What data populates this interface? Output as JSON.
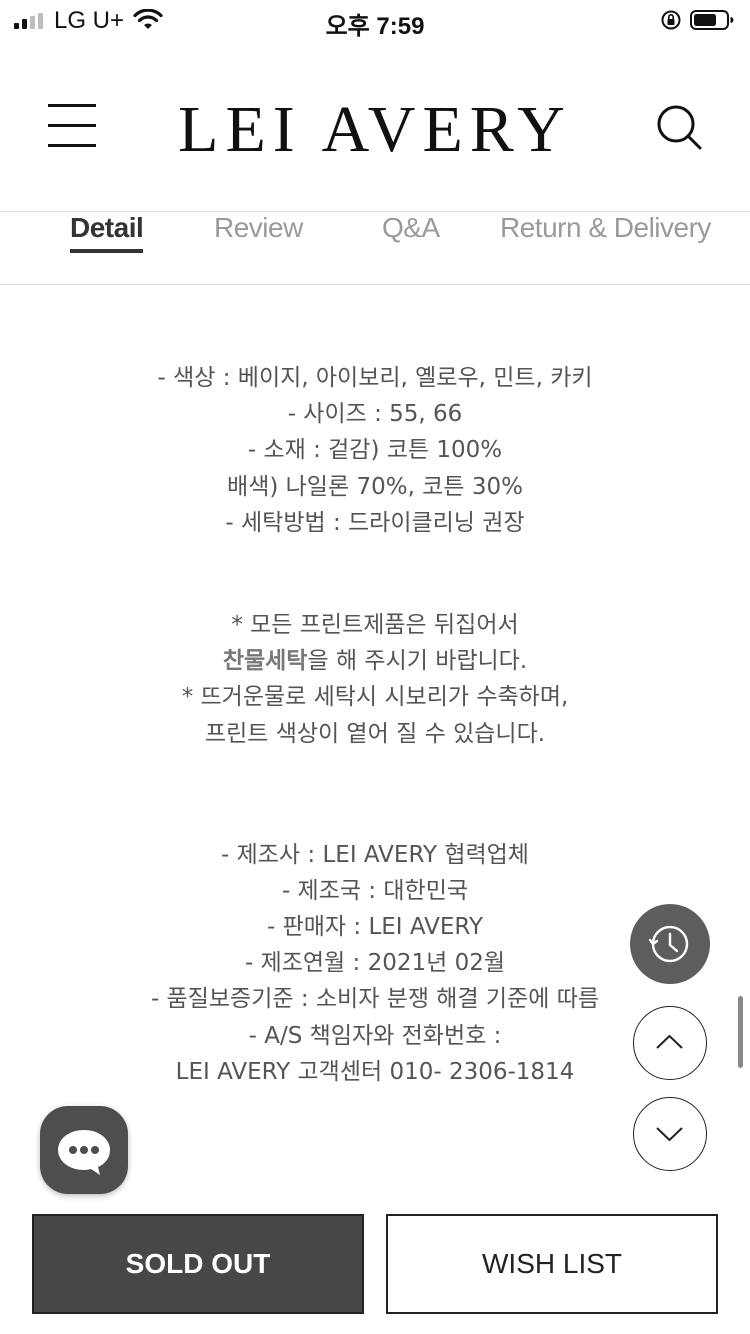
{
  "status_bar": {
    "carrier": "LG U+",
    "time": "오후 7:59"
  },
  "header": {
    "logo": "LEI AVERY",
    "menu_icon": "hamburger-menu-icon",
    "search_icon": "search-icon"
  },
  "tabs": [
    {
      "label": "Detail",
      "active": true
    },
    {
      "label": "Review",
      "active": false
    },
    {
      "label": "Q&A",
      "active": false
    },
    {
      "label": "Return & Delivery",
      "active": false
    }
  ],
  "detail": {
    "specs": [
      "- 색상 : 베이지, 아이보리, 옐로우, 민트, 카키",
      "- 사이즈 : 55, 66",
      "- 소재 : 겉감) 코튼 100%",
      "배색) 나일론 70%, 코튼 30%",
      "- 세탁방법 : 드라이클리닝 권장"
    ],
    "care": {
      "line1": "* 모든 프린트제품은 뒤집어서",
      "line2_bold": "찬물세탁",
      "line2_rest": "을 해 주시기 바랍니다.",
      "line3": "* 뜨거운물로 세탁시 시보리가 수축하며,",
      "line4": "프린트 색상이 옅어 질 수 있습니다."
    },
    "maker": [
      "- 제조사 : LEI AVERY 협력업체",
      "- 제조국 : 대한민국",
      "- 판매자 : LEI AVERY",
      "- 제조연월 : 2021년 02월",
      "- 품질보증기준 : 소비자 분쟁 해결 기준에 따름",
      "- A/S 책임자와 전화번호 :",
      "LEI AVERY 고객센터 010- 2306-1814"
    ]
  },
  "floating": {
    "history_icon": "clock-icon",
    "up_icon": "chevron-up-icon",
    "down_icon": "chevron-down-icon",
    "chat_icon": "chat-bubble-icon"
  },
  "actions": {
    "sold_out": "SOLD OUT",
    "wish_list": "WISH LIST"
  }
}
